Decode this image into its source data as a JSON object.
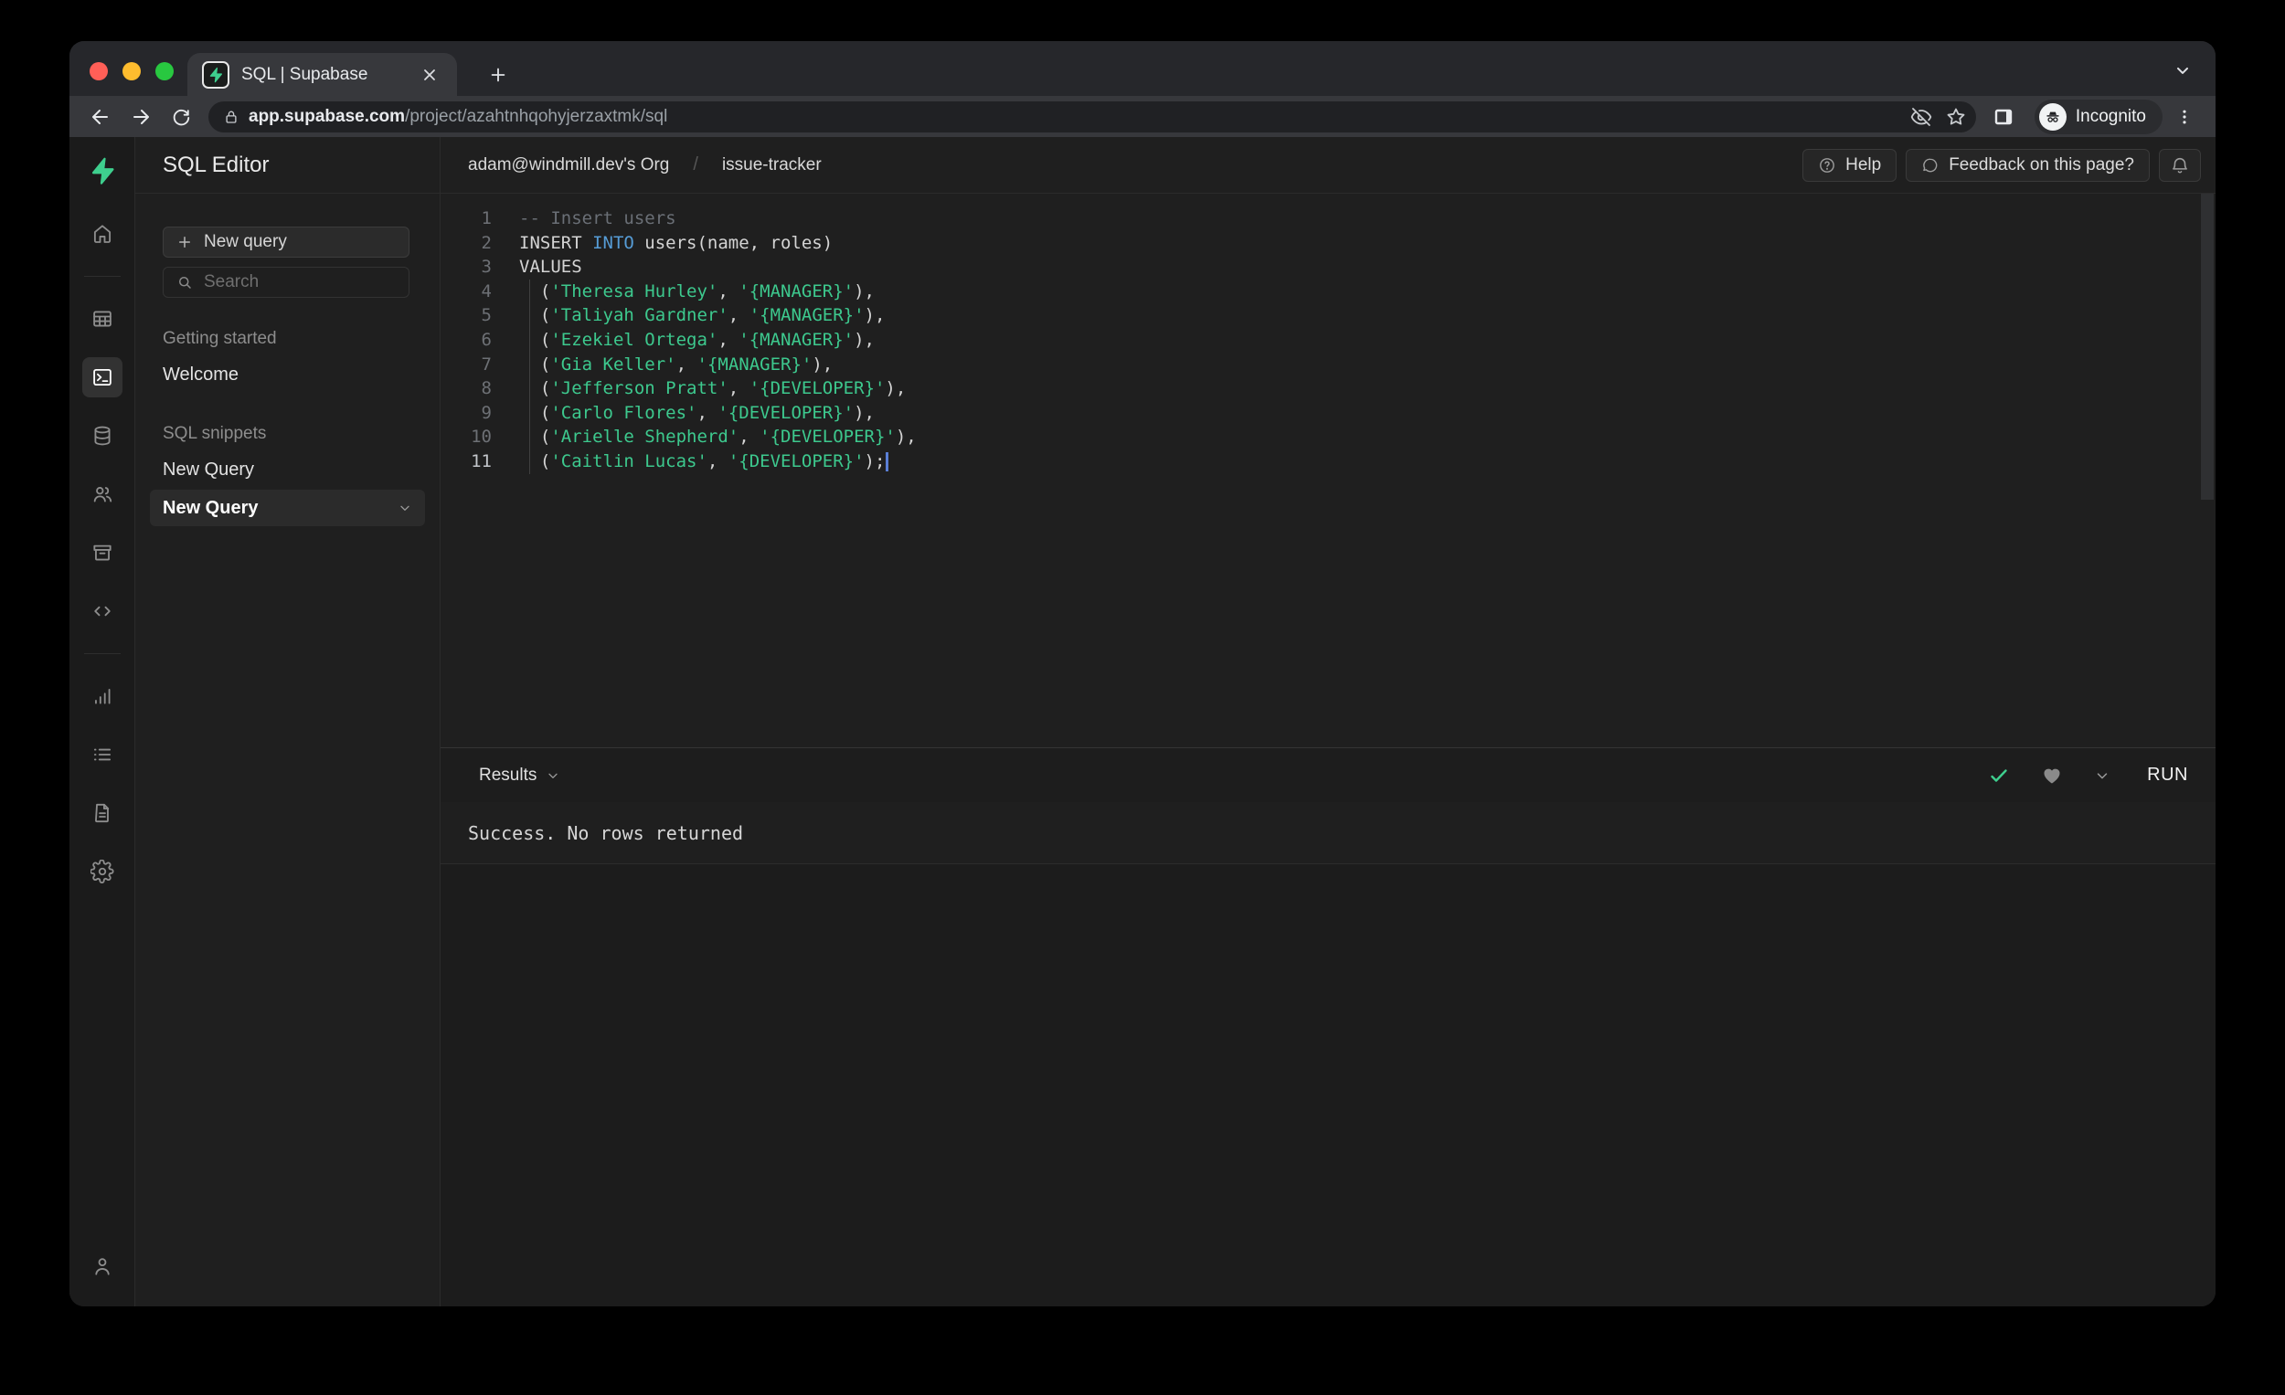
{
  "browser": {
    "tab_title": "SQL | Supabase",
    "url_domain": "app.supabase.com",
    "url_path": "/project/azahtnhqohyjerzaxtmk/sql",
    "incognito_label": "Incognito",
    "icons": [
      "back-icon",
      "forward-icon",
      "reload-icon",
      "lock-icon",
      "eye-off-icon",
      "star-icon",
      "side-panel-icon",
      "incognito-icon",
      "menu-dots-icon",
      "new-tab-icon",
      "close-icon",
      "chevron-down-icon"
    ]
  },
  "rail": {
    "icons": [
      {
        "name": "home-icon",
        "active": false
      },
      {
        "name": "divider",
        "divider": true
      },
      {
        "name": "table-editor-icon",
        "active": false
      },
      {
        "name": "sql-editor-icon",
        "active": true
      },
      {
        "name": "database-icon",
        "active": false
      },
      {
        "name": "auth-icon",
        "active": false
      },
      {
        "name": "storage-icon",
        "active": false
      },
      {
        "name": "api-icon",
        "active": false
      },
      {
        "name": "divider",
        "divider": true
      },
      {
        "name": "reports-icon",
        "active": false
      },
      {
        "name": "logs-icon",
        "active": false
      },
      {
        "name": "docs-icon",
        "active": false
      },
      {
        "name": "settings-icon",
        "active": false
      }
    ],
    "bottom_icon": "account-icon",
    "logo_icon": "supabase-logo"
  },
  "panel": {
    "title": "SQL Editor",
    "new_query_button": "New query",
    "search_placeholder": "Search",
    "sections": [
      {
        "label": "Getting started",
        "items": [
          {
            "label": "Welcome",
            "active": false
          }
        ]
      },
      {
        "label": "SQL snippets",
        "items": [
          {
            "label": "New Query",
            "active": false
          },
          {
            "label": "New Query",
            "active": true
          }
        ]
      }
    ]
  },
  "header": {
    "breadcrumb_org": "adam@windmill.dev's Org",
    "breadcrumb_separator": "/",
    "breadcrumb_project": "issue-tracker",
    "help_button": "Help",
    "feedback_button": "Feedback on this page?",
    "bell_icon": "bell-icon"
  },
  "editor": {
    "lines": [
      {
        "num": "1",
        "tokens": [
          {
            "t": "-- Insert users",
            "c": "comment"
          }
        ]
      },
      {
        "num": "2",
        "tokens": [
          {
            "t": "INSERT ",
            "c": "plain"
          },
          {
            "t": "INTO",
            "c": "keyword"
          },
          {
            "t": " users(name, roles)",
            "c": "plain"
          }
        ]
      },
      {
        "num": "3",
        "tokens": [
          {
            "t": "VALUES",
            "c": "plain"
          }
        ]
      },
      {
        "num": "4",
        "guide": true,
        "tokens": [
          {
            "t": "  (",
            "c": "plain"
          },
          {
            "t": "'Theresa Hurley'",
            "c": "string"
          },
          {
            "t": ", ",
            "c": "plain"
          },
          {
            "t": "'{MANAGER}'",
            "c": "string"
          },
          {
            "t": "),",
            "c": "plain"
          }
        ]
      },
      {
        "num": "5",
        "guide": true,
        "tokens": [
          {
            "t": "  (",
            "c": "plain"
          },
          {
            "t": "'Taliyah Gardner'",
            "c": "string"
          },
          {
            "t": ", ",
            "c": "plain"
          },
          {
            "t": "'{MANAGER}'",
            "c": "string"
          },
          {
            "t": "),",
            "c": "plain"
          }
        ]
      },
      {
        "num": "6",
        "guide": true,
        "tokens": [
          {
            "t": "  (",
            "c": "plain"
          },
          {
            "t": "'Ezekiel Ortega'",
            "c": "string"
          },
          {
            "t": ", ",
            "c": "plain"
          },
          {
            "t": "'{MANAGER}'",
            "c": "string"
          },
          {
            "t": "),",
            "c": "plain"
          }
        ]
      },
      {
        "num": "7",
        "guide": true,
        "tokens": [
          {
            "t": "  (",
            "c": "plain"
          },
          {
            "t": "'Gia Keller'",
            "c": "string"
          },
          {
            "t": ", ",
            "c": "plain"
          },
          {
            "t": "'{MANAGER}'",
            "c": "string"
          },
          {
            "t": "),",
            "c": "plain"
          }
        ]
      },
      {
        "num": "8",
        "guide": true,
        "tokens": [
          {
            "t": "  (",
            "c": "plain"
          },
          {
            "t": "'Jefferson Pratt'",
            "c": "string"
          },
          {
            "t": ", ",
            "c": "plain"
          },
          {
            "t": "'{DEVELOPER}'",
            "c": "string"
          },
          {
            "t": "),",
            "c": "plain"
          }
        ]
      },
      {
        "num": "9",
        "guide": true,
        "tokens": [
          {
            "t": "  (",
            "c": "plain"
          },
          {
            "t": "'Carlo Flores'",
            "c": "string"
          },
          {
            "t": ", ",
            "c": "plain"
          },
          {
            "t": "'{DEVELOPER}'",
            "c": "string"
          },
          {
            "t": "),",
            "c": "plain"
          }
        ]
      },
      {
        "num": "10",
        "guide": true,
        "tokens": [
          {
            "t": "  (",
            "c": "plain"
          },
          {
            "t": "'Arielle Shepherd'",
            "c": "string"
          },
          {
            "t": ", ",
            "c": "plain"
          },
          {
            "t": "'{DEVELOPER}'",
            "c": "string"
          },
          {
            "t": "),",
            "c": "plain"
          }
        ]
      },
      {
        "num": "11",
        "guide": true,
        "active": true,
        "cursor": true,
        "tokens": [
          {
            "t": "  (",
            "c": "plain"
          },
          {
            "t": "'Caitlin Lucas'",
            "c": "string"
          },
          {
            "t": ", ",
            "c": "plain"
          },
          {
            "t": "'{DEVELOPER}'",
            "c": "string"
          },
          {
            "t": ");",
            "c": "plain"
          }
        ]
      }
    ]
  },
  "results": {
    "label": "Results",
    "run_button": "RUN",
    "message": "Success. No rows returned",
    "icons": [
      "check-icon",
      "heart-icon",
      "chevron-down-icon"
    ]
  },
  "colors": {
    "accent_green": "#3ecf8e",
    "keyword_blue": "#569cd6",
    "string_green": "#3dc98e",
    "comment_gray": "#6a6f76",
    "editor_bg": "#1f1f1f",
    "chrome_toolbar": "#37383c"
  }
}
